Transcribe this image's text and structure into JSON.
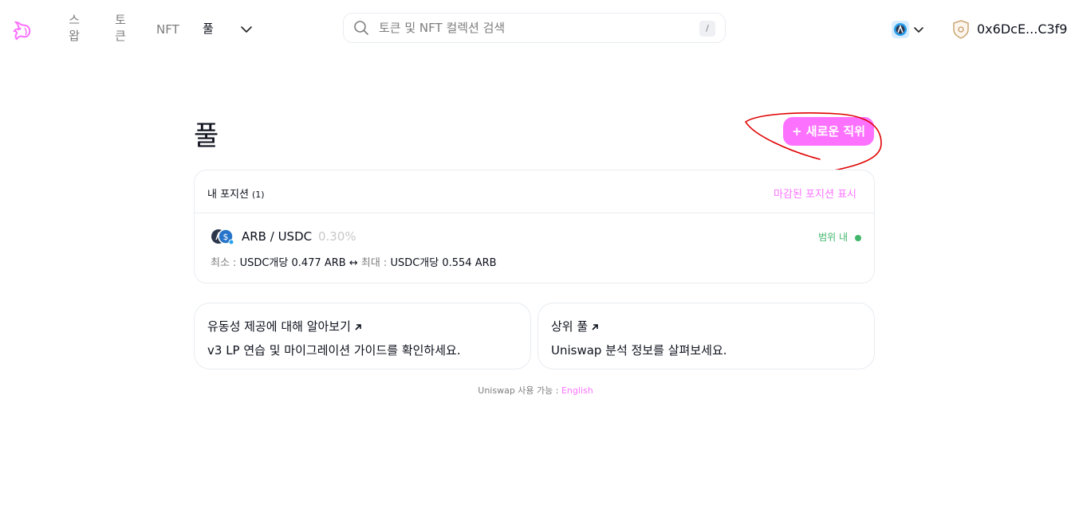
{
  "nav": {
    "swap_label": "스왑",
    "swap_line1": "스",
    "swap_line2": "왑",
    "token_label": "토큰",
    "token_line1": "토",
    "token_line2": "큰",
    "nft_label": "NFT",
    "pool_label": "풀",
    "active_item": "풀"
  },
  "search": {
    "placeholder": "토큰 및 NFT 컬렉션 검색",
    "shortcut": "/"
  },
  "wallet": {
    "address": "0x6DcE...C3f9"
  },
  "icons": {
    "logo": "uniswap-unicorn-icon",
    "search": "search-icon",
    "chain": "arbitrum-icon",
    "wallet": "wallet-identicon"
  },
  "page": {
    "title": "풀",
    "new_position_label": "+ 새로운 직위"
  },
  "positions": {
    "header_label": "내 포지션",
    "count": "(1)",
    "closed_toggle": "마감된 포지션 표시",
    "items": [
      {
        "pair": "ARB / USDC",
        "fee": "0.30%",
        "status": "범위 내",
        "min_label": "최소 :",
        "min_value": "USDC개당 0.477 ARB",
        "arrow": "↔",
        "max_label": "최대 :",
        "max_value": "USDC개당 0.554 ARB"
      }
    ]
  },
  "cards": {
    "learn_title": "유동성 제공에 대해 알아보기",
    "learn_desc": "v3 LP 연습 및 마이그레이션 가이드를 확인하세요.",
    "top_title": "상위 풀",
    "top_desc": "Uniswap 분석 정보를 살펴보세요."
  },
  "footer": {
    "text": "Uniswap 사용 가능 :",
    "link": "English"
  },
  "colors": {
    "accent": "#fc72ff",
    "in_range": "#40b66b",
    "annotation": "#e00000"
  }
}
